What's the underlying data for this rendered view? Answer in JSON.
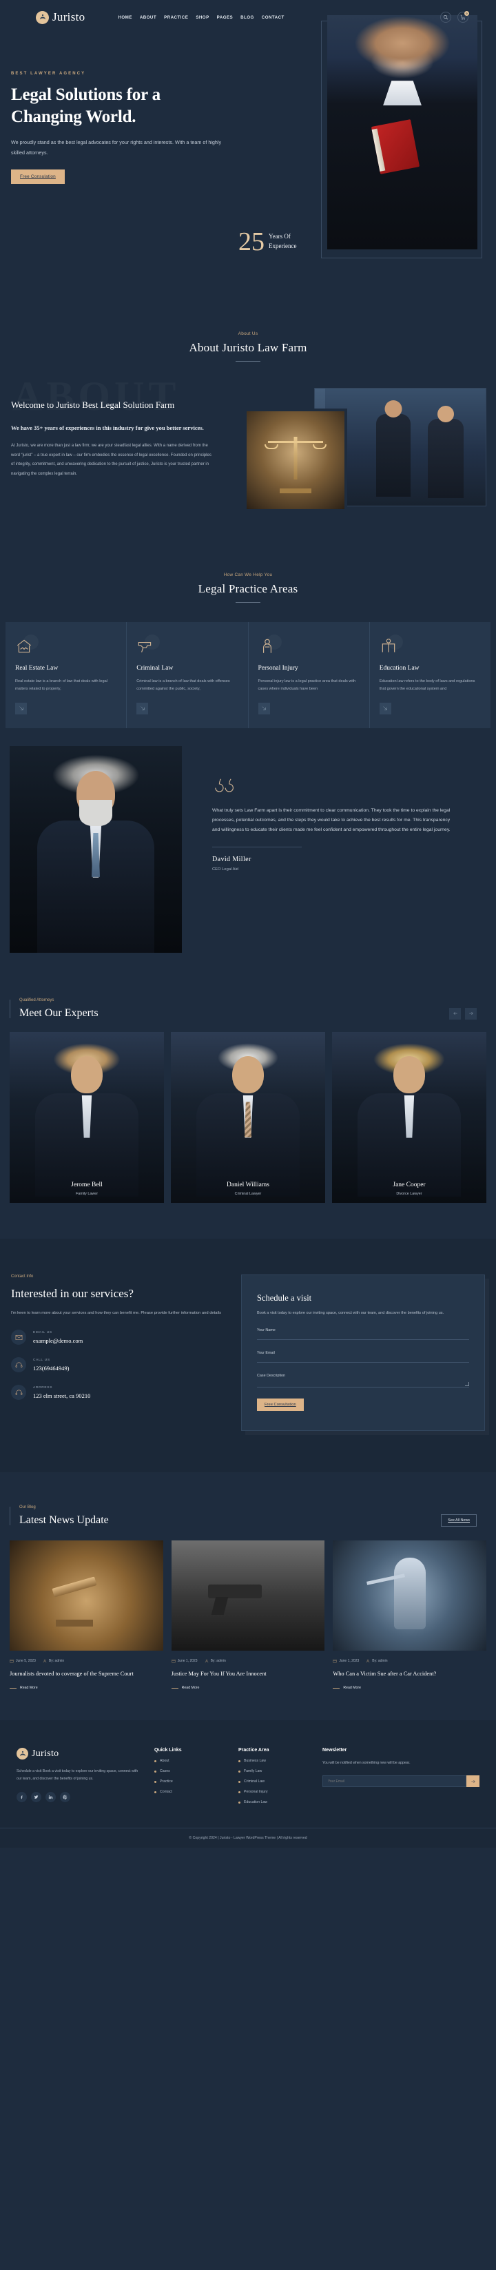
{
  "brand": {
    "name": "Juristo",
    "logo_icon": "scales-in-hands-icon"
  },
  "header": {
    "nav": [
      {
        "label": "HOME"
      },
      {
        "label": "ABOUT"
      },
      {
        "label": "PRACTICE"
      },
      {
        "label": "SHOP"
      },
      {
        "label": "PAGES"
      },
      {
        "label": "BLOG"
      },
      {
        "label": "CONTACT"
      }
    ],
    "search_icon": "search-icon",
    "cart_icon": "cart-icon",
    "cart_count": "0"
  },
  "hero": {
    "eyebrow": "BEST LAWYER AGENCY",
    "title_line1": "Legal Solutions for a",
    "title_line2": "Changing World.",
    "paragraph": "We proudly stand as the best legal advocates for your rights and interests. With a team of highly skilled attorneys.",
    "cta": "Free Consulation",
    "experience_number": "25",
    "experience_label_1": "Years Of",
    "experience_label_2": "Experience"
  },
  "about": {
    "eyebrow": "About Us",
    "title": "About Juristo Law Farm",
    "ghost_word": "ABOUT",
    "heading": "Welcome to Juristo Best Legal Solution Farm",
    "subheading": "We have 35+ years of experiences in this industry for give you better services.",
    "paragraph": "At Juristo, we are more than just a law firm; we are your steadfast legal allies. With a name derived from the word “jurist” – a true expert in law – our firm embodies the essence of legal excellence. Founded on principles of integrity, commitment, and unwavering dedication to the pursuit of justice, Juristo is your trusted partner in navigating the complex legal terrain."
  },
  "practice": {
    "eyebrow": "How Can We Help You",
    "title": "Legal Practice Areas",
    "cards": [
      {
        "icon": "house-handshake-icon",
        "title": "Real Estate Law",
        "text": "Real estate law is a branch of law that deals with legal matters related to property,"
      },
      {
        "icon": "handgun-icon",
        "title": "Criminal Law",
        "text": "Criminal law is a branch of law that deals with offenses committed against the public, society,"
      },
      {
        "icon": "injured-person-icon",
        "title": "Personal Injury",
        "text": "Personal injury law is a legal practice area that deals with cases where individuals have been"
      },
      {
        "icon": "graduate-book-icon",
        "title": "Education Law",
        "text": "Education law refers to the body of laws and regulations that govern the educational system and"
      }
    ]
  },
  "testimonial": {
    "quote_icon": "quote-icon",
    "text": "What truly sets Law Farm apart is their commitment to clear communication. They took the time to explain the legal processes, potential outcomes, and the steps they would take to achieve the best results for me. This transparency and willingness to educate their clients made me feel confident and empowered throughout the entire legal journey.",
    "author": "David Miller",
    "role": "CEO Legal Aid"
  },
  "team": {
    "eyebrow": "Qualified Attorneys",
    "title": "Meet Our Experts",
    "prev_icon": "arrow-left-icon",
    "next_icon": "arrow-right-icon",
    "members": [
      {
        "name": "Jerome Bell",
        "role": "Family Lawer"
      },
      {
        "name": "Daniel Williams",
        "role": "Criminal Lawyer"
      },
      {
        "name": "Jane Cooper",
        "role": "Divorce Lawyer"
      }
    ]
  },
  "contact": {
    "eyebrow": "Contact Info",
    "title": "Interested in our services?",
    "subtitle": "I'm keen to learn more about your services and how they can benefit me. Please provide further information and details",
    "items": [
      {
        "icon": "mail-icon",
        "label": "EMAIL US",
        "value": "example@demo.com"
      },
      {
        "icon": "headset-icon",
        "label": "CALL US",
        "value": "123(69464949)"
      },
      {
        "icon": "headset-icon",
        "label": "ADDRESS",
        "value": "123 elm street, ca 90210"
      }
    ],
    "form": {
      "title": "Schedule a visit",
      "subtitle": "Book a visit today to explore our inviting space, connect with our team, and discover the benefits of joining us.",
      "fields": [
        {
          "label": "Your Name"
        },
        {
          "label": "Your Email"
        },
        {
          "label": "Case Description"
        }
      ],
      "submit": "Free Consultation"
    }
  },
  "blog": {
    "eyebrow": "Our Blog",
    "title": "Latest News Update",
    "see_all": "See All News",
    "posts": [
      {
        "date": "June 5, 2023",
        "author": "By: admin",
        "title": "Journalists devoted to coverage of the Supreme Court",
        "read_more": "Read More",
        "image": "gavel-image"
      },
      {
        "date": "June 1, 2023",
        "author": "By: admin",
        "title": "Justice May For You If You Are Innocent",
        "read_more": "Read More",
        "image": "handgun-image"
      },
      {
        "date": "June 1, 2023",
        "author": "By: admin",
        "title": "Who Can a Victim Sue after a Car Accident?",
        "read_more": "Read More",
        "image": "lady-justice-image"
      }
    ]
  },
  "footer": {
    "about": "Schedule a visit Book a visit today to explore our inviting space, connect with our team, and discover the benefits of joining us.",
    "social": [
      "facebook-icon",
      "twitter-icon",
      "linkedin-icon",
      "pinterest-icon"
    ],
    "quick_links_title": "Quick Links",
    "quick_links": [
      "About",
      "Cases",
      "Practice",
      "Contact"
    ],
    "practice_title": "Practice Area",
    "practice_links": [
      "Business Law",
      "Family Law",
      "Criminal Law",
      "Personal Injury",
      "Education Law"
    ],
    "newsletter_title": "Newsletter",
    "newsletter_text": "You will be notified when something new will be appear.",
    "newsletter_placeholder": "Your Email",
    "newsletter_icon": "send-icon",
    "copyright": "© Copyright 2024 | Juristo - Lawyer WordPress Theme | All rights reserved"
  }
}
